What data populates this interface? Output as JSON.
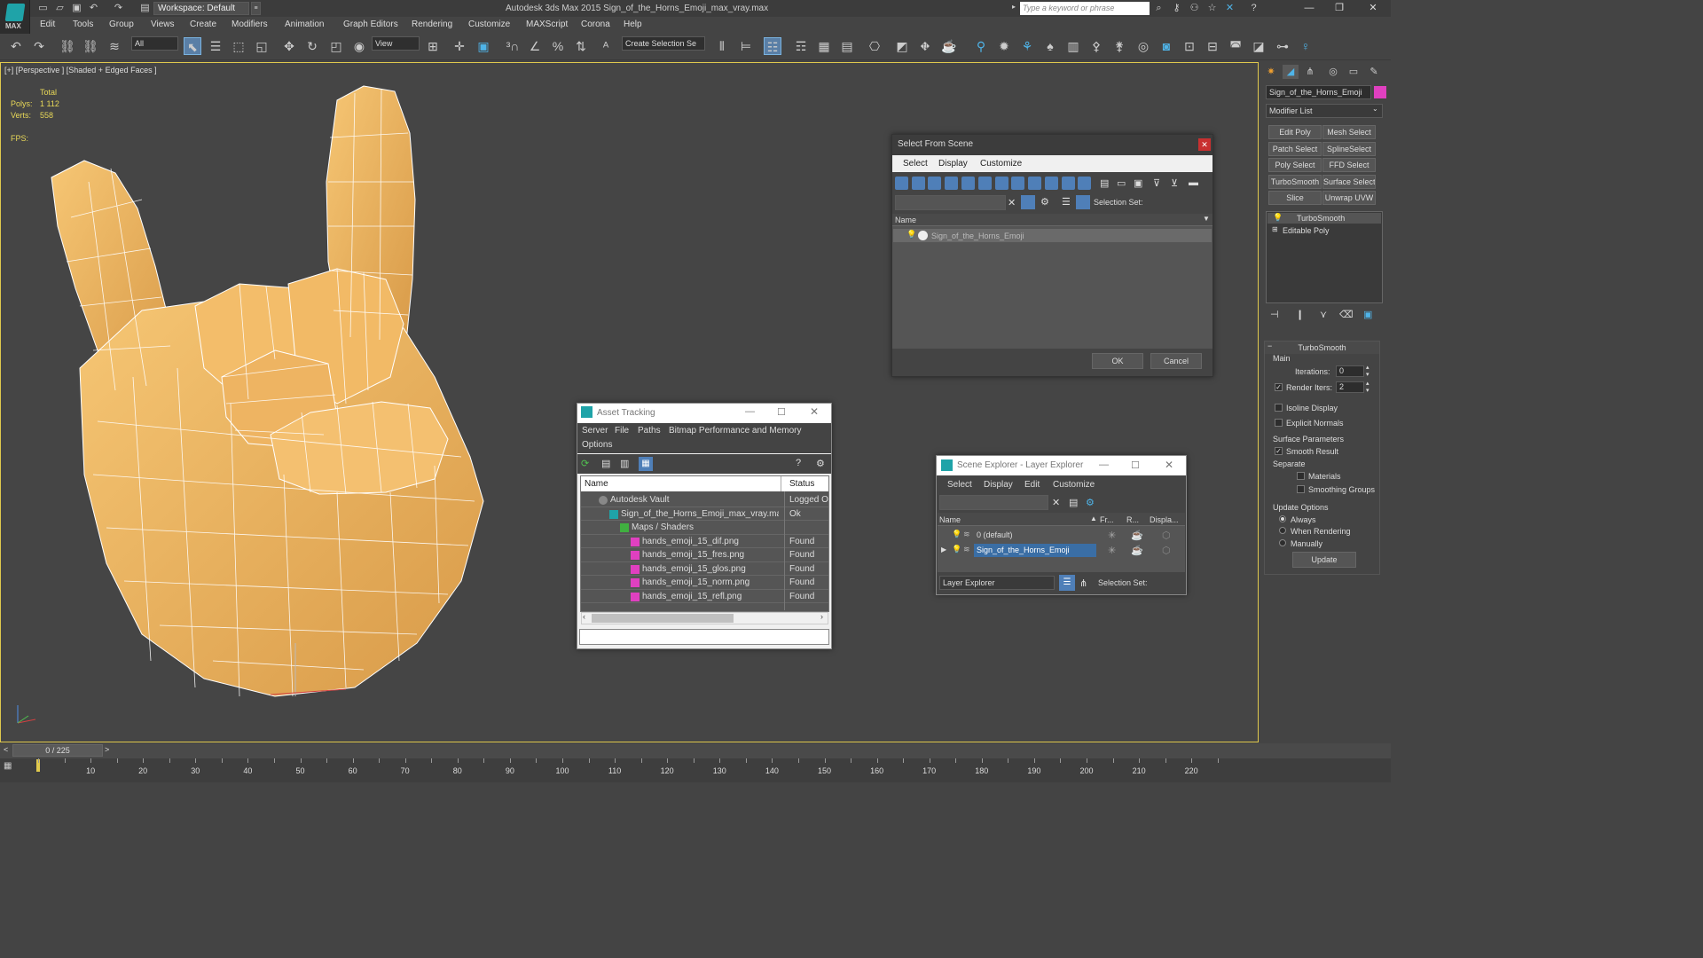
{
  "app": {
    "title": "Autodesk 3ds Max  2015     Sign_of_the_Horns_Emoji_max_vray.max",
    "logo_text": "MAX",
    "workspace": "Workspace: Default",
    "search_placeholder": "Type a keyword or phrase"
  },
  "menus": [
    "Edit",
    "Tools",
    "Group",
    "Views",
    "Create",
    "Modifiers",
    "Animation",
    "Graph Editors",
    "Rendering",
    "Customize",
    "MAXScript",
    "Corona",
    "Help"
  ],
  "toolbar": {
    "filter_value": "All",
    "coord_value": "View",
    "selection_set_value": "Create Selection Se"
  },
  "viewport": {
    "label": "[+] [Perspective ] [Shaded + Edged Faces ]",
    "stats_header": "Total",
    "polys_label": "Polys:",
    "polys_value": "1 112",
    "verts_label": "Verts:",
    "verts_value": "558",
    "fps_label": "FPS:",
    "model_color": "#f0b864",
    "edge_color": "#ffffff"
  },
  "command_panel": {
    "object_name": "Sign_of_the_Horns_Emoji",
    "object_color": "#e040c0",
    "modifier_list": "Modifier List",
    "modifier_buttons": [
      "Edit Poly",
      "Mesh Select",
      "Patch Select",
      "SplineSelect",
      "Poly Select",
      "FFD Select",
      "TurboSmooth",
      "Surface Select",
      "Slice",
      "Unwrap UVW"
    ],
    "stack": [
      "TurboSmooth",
      "Editable Poly"
    ],
    "rollout_title": "TurboSmooth",
    "main_label": "Main",
    "iterations_label": "Iterations:",
    "iterations_value": "0",
    "render_iters_label": "Render Iters:",
    "render_iters_value": "2",
    "isoline_label": "Isoline Display",
    "explicit_normals_label": "Explicit Normals",
    "surface_params_label": "Surface Parameters",
    "smooth_result_label": "Smooth Result",
    "separate_label": "Separate",
    "materials_label": "Materials",
    "smoothing_groups_label": "Smoothing Groups",
    "update_options_label": "Update Options",
    "always_label": "Always",
    "when_rendering_label": "When Rendering",
    "manually_label": "Manually",
    "update_button": "Update"
  },
  "select_from_scene": {
    "title": "Select From Scene",
    "menus": [
      "Select",
      "Display",
      "Customize"
    ],
    "selection_set_label": "Selection Set:",
    "column_name": "Name",
    "items": [
      "Sign_of_the_Horns_Emoji"
    ],
    "ok": "OK",
    "cancel": "Cancel"
  },
  "asset_tracking": {
    "title": "Asset Tracking",
    "menus": [
      "Server",
      "File",
      "Paths",
      "Bitmap Performance and Memory",
      "Options"
    ],
    "col_name": "Name",
    "col_status": "Status",
    "rows": [
      {
        "name": "Autodesk Vault",
        "status": "Logged Ou",
        "indent": 0,
        "icon": "vault"
      },
      {
        "name": "Sign_of_the_Horns_Emoji_max_vray.max",
        "status": "Ok",
        "indent": 1,
        "icon": "max"
      },
      {
        "name": "Maps / Shaders",
        "status": "",
        "indent": 2,
        "icon": "maps"
      },
      {
        "name": "hands_emoji_15_dif.png",
        "status": "Found",
        "indent": 3,
        "icon": "png"
      },
      {
        "name": "hands_emoji_15_fres.png",
        "status": "Found",
        "indent": 3,
        "icon": "png"
      },
      {
        "name": "hands_emoji_15_glos.png",
        "status": "Found",
        "indent": 3,
        "icon": "png"
      },
      {
        "name": "hands_emoji_15_norm.png",
        "status": "Found",
        "indent": 3,
        "icon": "png"
      },
      {
        "name": "hands_emoji_15_refl.png",
        "status": "Found",
        "indent": 3,
        "icon": "png"
      }
    ]
  },
  "scene_explorer": {
    "title": "Scene Explorer - Layer Explorer",
    "menus": [
      "Select",
      "Display",
      "Edit",
      "Customize"
    ],
    "col_name": "Name",
    "col_fr": "Fr...",
    "col_r": "R...",
    "col_disp": "Displa...",
    "layers": [
      {
        "name": "0 (default)",
        "selected": false
      },
      {
        "name": "Sign_of_the_Horns_Emoji",
        "selected": true
      }
    ],
    "explorer_dropdown": "Layer Explorer",
    "selection_set_label": "Selection Set:"
  },
  "timeline": {
    "frame_display": "0 / 225",
    "ticks": [
      "10",
      "20",
      "30",
      "40",
      "50",
      "60",
      "70",
      "80",
      "90",
      "100",
      "110",
      "120",
      "130",
      "140",
      "150",
      "160",
      "170",
      "180",
      "190",
      "200",
      "210",
      "220"
    ]
  }
}
